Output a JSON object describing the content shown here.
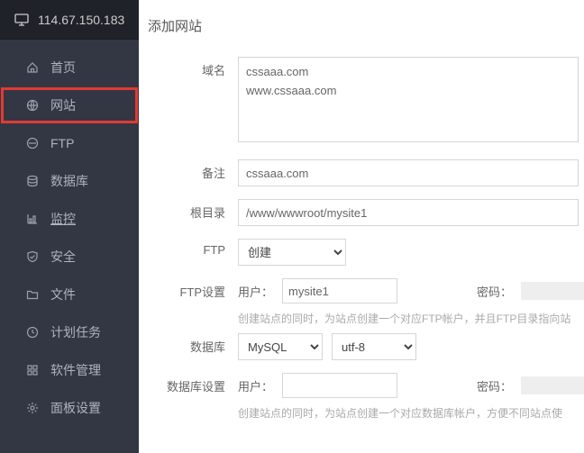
{
  "ip": "114.67.150.183",
  "nav": {
    "home": "首页",
    "site": "网站",
    "ftp": "FTP",
    "db": "数据库",
    "monitor": "监控",
    "security": "安全",
    "files": "文件",
    "cron": "计划任务",
    "soft": "软件管理",
    "panel": "面板设置"
  },
  "title": "添加网站",
  "labels": {
    "domain": "域名",
    "remark": "备注",
    "root": "根目录",
    "ftp": "FTP",
    "ftpset": "FTP设置",
    "db": "数据库",
    "dbset": "数据库设置",
    "user": "用户：",
    "pwd": "密码："
  },
  "values": {
    "domains": "cssaaa.com\nwww.cssaaa.com",
    "remark": "cssaaa.com",
    "root": "/www/wwwroot/mysite1",
    "ftp_sel": "创建",
    "ftp_user": "mysite1",
    "db_engine": "MySQL",
    "db_charset": "utf-8",
    "db_user": ""
  },
  "hints": {
    "ftp": "创建站点的同时，为站点创建一个对应FTP帐户，并且FTP目录指向站",
    "db": "创建站点的同时，为站点创建一个对应数据库帐户，方便不同站点使"
  }
}
